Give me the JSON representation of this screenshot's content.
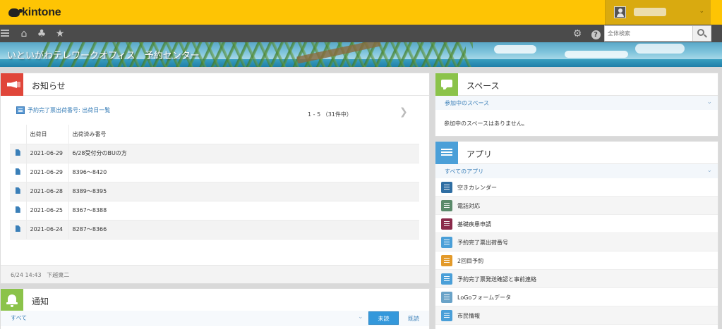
{
  "header": {
    "logo_text": "kintone",
    "user_name": ""
  },
  "navbar": {
    "search_placeholder": "全体検索"
  },
  "banner": {
    "title": "いといがわテレワークオフィス　予約センター"
  },
  "notice": {
    "title": "お知らせ",
    "list_link": "予約完了票出荷番号: 出荷日一覧",
    "pager": "1 - 5 （31件中）",
    "columns": [
      "出荷日",
      "出荷済み番号"
    ],
    "rows": [
      {
        "date": "2021-06-29",
        "number": "6/28受付分のBUの方"
      },
      {
        "date": "2021-06-29",
        "number": "8396～8420"
      },
      {
        "date": "2021-06-28",
        "number": "8389～8395"
      },
      {
        "date": "2021-06-25",
        "number": "8367～8388"
      },
      {
        "date": "2021-06-24",
        "number": "8287～8366"
      }
    ],
    "footer_timestamp": "6/24 14:43",
    "footer_author": "下越東二"
  },
  "notifications": {
    "title": "通知",
    "filter_label": "すべて",
    "unread_label": "未読",
    "read_label": "既読"
  },
  "space": {
    "title": "スペース",
    "filter_label": "参加中のスペース",
    "empty_text": "参加中のスペースはありません。"
  },
  "apps": {
    "title": "アプリ",
    "filter_label": "すべてのアプリ",
    "items": [
      {
        "name": "空きカレンダー",
        "color": "#2f6ea3"
      },
      {
        "name": "電話対応",
        "color": "#5a8a6a"
      },
      {
        "name": "基礎疾患申請",
        "color": "#8a2a4a"
      },
      {
        "name": "予約完了票出荷番号",
        "color": "#4a9fd8"
      },
      {
        "name": "2回目予約",
        "color": "#e39a2a"
      },
      {
        "name": "予約完了票発送確認と事前連絡",
        "color": "#4a9fd8"
      },
      {
        "name": "LoGoフォームデータ",
        "color": "#6aa3c8"
      },
      {
        "name": "市民情報",
        "color": "#4a9fd8"
      }
    ]
  },
  "colors": {
    "brand_yellow": "#fec404",
    "nav_dark": "#4b4b4b",
    "link_blue": "#3a7fb8",
    "notice_red": "#e0463a",
    "space_green": "#8bc34a",
    "apps_blue": "#4a9fd8"
  }
}
